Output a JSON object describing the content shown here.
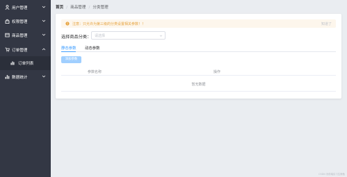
{
  "sidebar": {
    "items": [
      {
        "label": "用户管理",
        "icon": "user-icon"
      },
      {
        "label": "权限管理",
        "icon": "lock-icon"
      },
      {
        "label": "商品管理",
        "icon": "goods-icon"
      },
      {
        "label": "订单管理",
        "icon": "order-icon"
      },
      {
        "label": "数据统计",
        "icon": "chart-icon"
      }
    ],
    "sub_item": {
      "label": "订单列表",
      "icon": "list-icon"
    }
  },
  "breadcrumb": {
    "home": "首页",
    "level1": "商品管理",
    "level2": "分类管理"
  },
  "alert": {
    "text": "注意：只允许为第三级的分类设置相关参数！！",
    "close_label": "知道了"
  },
  "category": {
    "label": "选择商品分类：",
    "placeholder": "请选择"
  },
  "tabs": {
    "dynamic": "静态参数",
    "static": "动态参数"
  },
  "add_button": "添加参数",
  "table": {
    "columns": [
      "参数名称",
      "操作"
    ],
    "empty_text": "暂无数据"
  },
  "watermark": "CSDN @前端实习生鲸鱼"
}
